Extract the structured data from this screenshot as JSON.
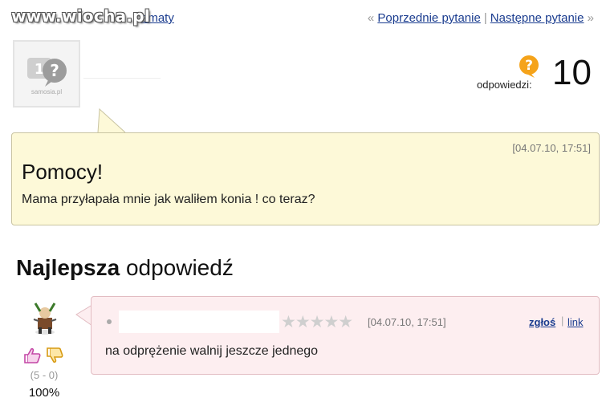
{
  "watermark": "www.wiocha.pl",
  "header": {
    "topics_link": "ematy",
    "prev_arrow": "«",
    "prev_label": "Poprzednie pytanie",
    "separator": "|",
    "next_label": "Następne pytanie",
    "next_arrow": "»"
  },
  "asker": {
    "avatar_text": "samosia.pl"
  },
  "answers_summary": {
    "label": "odpowiedzi:",
    "count": "10",
    "icon": "question-bubble-icon"
  },
  "question": {
    "date": "[04.07.10, 17:51]",
    "title": "Pomocy!",
    "body": "Mama przyłapała mnie jak waliłem konia ! co teraz?"
  },
  "best_answer": {
    "heading_bold": "Najlepsza",
    "heading_rest": " odpowiedź",
    "stars": "★★★★★",
    "date": "[04.07.10, 17:51]",
    "report_label": "zgłoś",
    "link_separator": "|",
    "link_label": "link",
    "body": "na odprężenie walnij jeszcze jednego",
    "votes": {
      "score": "(5 - 0)",
      "percent": "100%"
    }
  },
  "colors": {
    "question_bg": "#fdf9d8",
    "answer_bg": "#fdeef0",
    "link": "#1a3c8f",
    "accent_orange": "#f5a31a"
  }
}
